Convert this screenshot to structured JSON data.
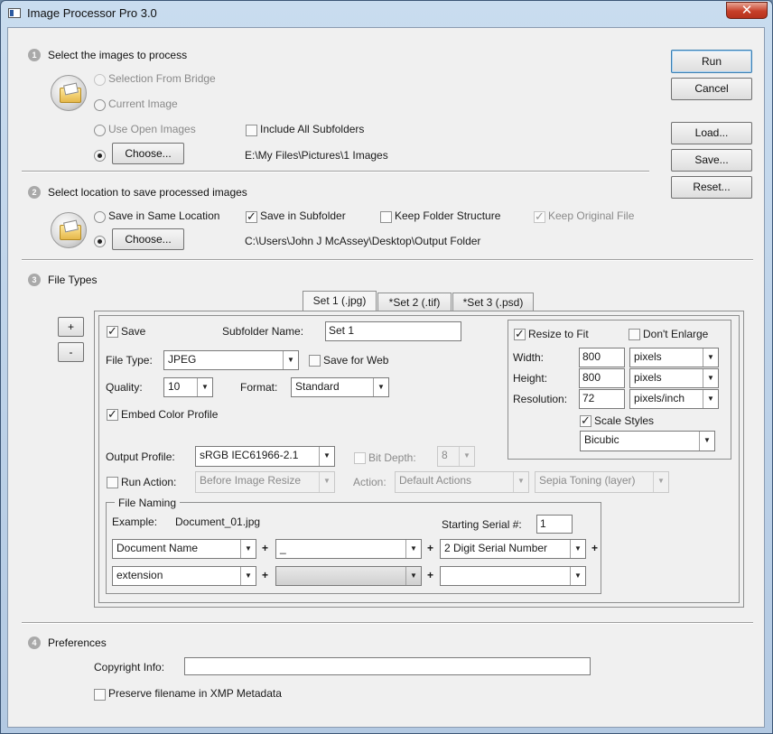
{
  "window": {
    "title": "Image Processor Pro 3.0",
    "close": "✕"
  },
  "side_buttons": {
    "run": "Run",
    "cancel": "Cancel",
    "load": "Load...",
    "save": "Save...",
    "reset": "Reset..."
  },
  "section1": {
    "number": "1",
    "title": "Select the images to process",
    "opt_bridge": "Selection From Bridge",
    "opt_current": "Current Image",
    "opt_open": "Use Open Images",
    "include_subfolders": "Include All Subfolders",
    "choose": "Choose...",
    "path": "E:\\My Files\\Pictures\\1 Images"
  },
  "section2": {
    "number": "2",
    "title": "Select location to save processed images",
    "opt_same": "Save in Same Location",
    "save_subfolder": "Save in Subfolder",
    "keep_structure": "Keep Folder Structure",
    "keep_original": "Keep Original File",
    "choose": "Choose...",
    "path": "C:\\Users\\John J McAssey\\Desktop\\Output Folder"
  },
  "section3": {
    "number": "3",
    "title": "File Types",
    "add": "+",
    "remove": "-",
    "tabs": [
      "Set 1 (.jpg)",
      "*Set 2 (.tif)",
      "*Set 3 (.psd)"
    ],
    "save_label": "Save",
    "subfolder_label": "Subfolder Name:",
    "subfolder_value": "Set 1",
    "filetype_label": "File Type:",
    "filetype_value": "JPEG",
    "save_for_web": "Save for Web",
    "quality_label": "Quality:",
    "quality_value": "10",
    "format_label": "Format:",
    "format_value": "Standard",
    "embed_profile": "Embed Color Profile",
    "output_profile_label": "Output Profile:",
    "output_profile_value": "sRGB IEC61966-2.1",
    "bit_depth_label": "Bit Depth:",
    "bit_depth_value": "8",
    "run_action_label": "Run Action:",
    "run_action_value": "Before Image Resize",
    "action_label": "Action:",
    "action_set_value": "Default Actions",
    "action_value": "Sepia Toning (layer)",
    "resize": {
      "resize_to_fit": "Resize to Fit",
      "dont_enlarge": "Don't Enlarge",
      "width_label": "Width:",
      "width_value": "800",
      "width_unit": "pixels",
      "height_label": "Height:",
      "height_value": "800",
      "height_unit": "pixels",
      "resolution_label": "Resolution:",
      "resolution_value": "72",
      "resolution_unit": "pixels/inch",
      "scale_styles": "Scale Styles",
      "method": "Bicubic"
    },
    "naming": {
      "legend": "File Naming",
      "example_label": "Example:",
      "example_value": "Document_01.jpg",
      "serial_label": "Starting Serial #:",
      "serial_value": "1",
      "row1": [
        "Document Name",
        "_",
        "2 Digit Serial Number"
      ],
      "row2": [
        "extension",
        "",
        ""
      ],
      "plus": "+"
    }
  },
  "section4": {
    "number": "4",
    "title": "Preferences",
    "copyright_label": "Copyright Info:",
    "copyright_value": "",
    "preserve_filename": "Preserve filename in XMP Metadata"
  }
}
